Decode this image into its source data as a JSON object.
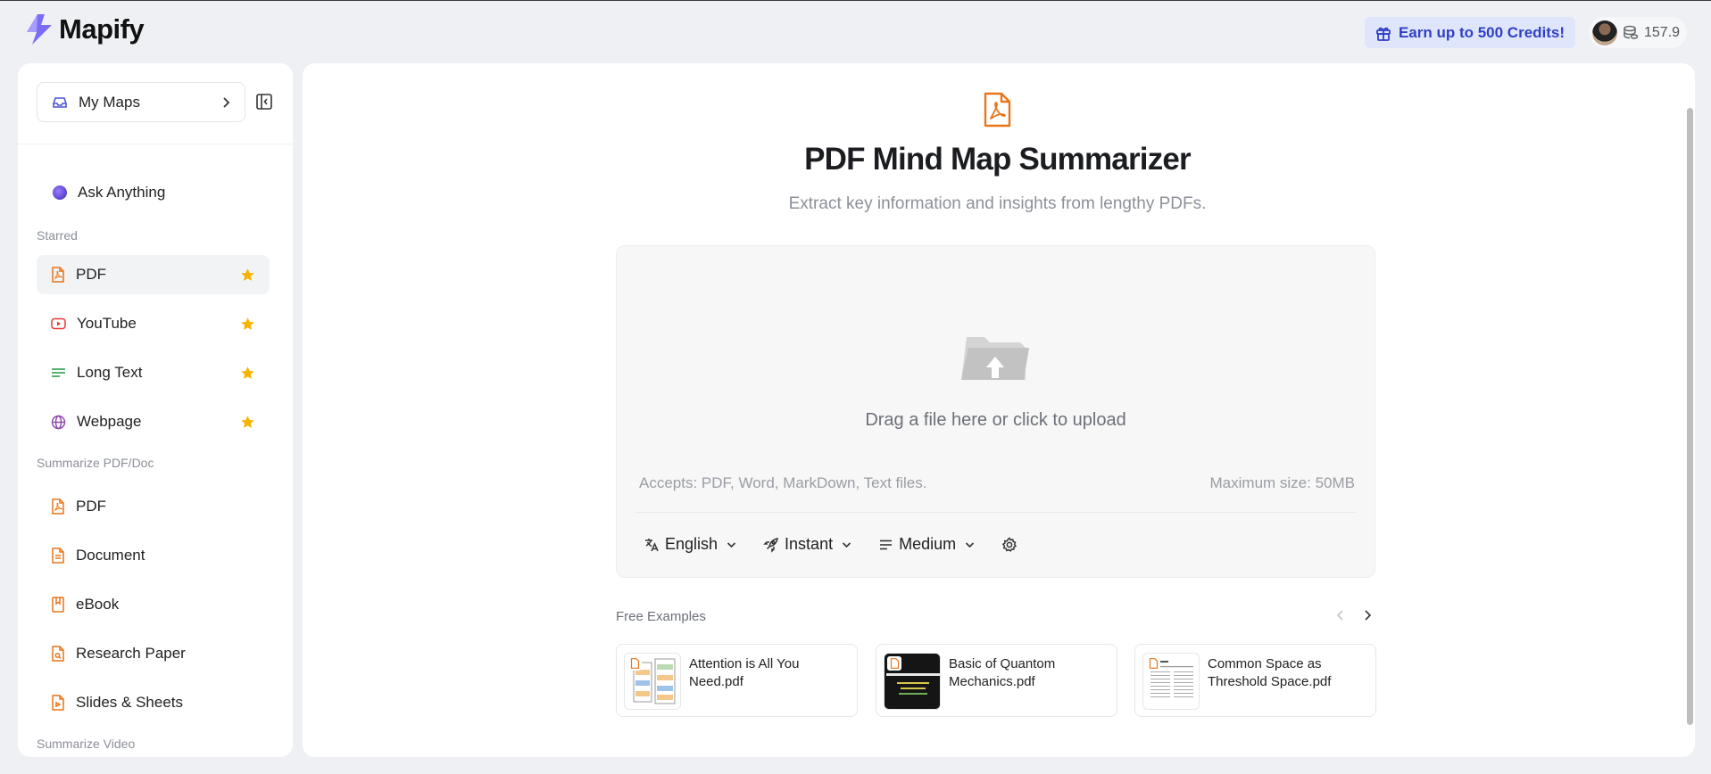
{
  "app": {
    "name": "Mapify"
  },
  "header": {
    "credits_label": "Earn up to 500 Credits!",
    "credit_balance": "157.9"
  },
  "sidebar": {
    "my_maps_label": "My Maps",
    "ask_anything": "Ask Anything",
    "starred_title": "Starred",
    "starred": [
      {
        "label": "PDF",
        "icon": "pdf-icon",
        "color": "#e8751a"
      },
      {
        "label": "YouTube",
        "icon": "youtube-icon",
        "color": "#e53935"
      },
      {
        "label": "Long Text",
        "icon": "long-text-icon",
        "color": "#2e9e4f"
      },
      {
        "label": "Webpage",
        "icon": "globe-icon",
        "color": "#8e44ad"
      }
    ],
    "summarize_doc_title": "Summarize PDF/Doc",
    "summarize_doc": [
      {
        "label": "PDF",
        "icon": "pdf-icon"
      },
      {
        "label": "Document",
        "icon": "document-icon"
      },
      {
        "label": "eBook",
        "icon": "ebook-icon"
      },
      {
        "label": "Research Paper",
        "icon": "research-paper-icon"
      },
      {
        "label": "Slides & Sheets",
        "icon": "slides-icon"
      }
    ],
    "summarize_video_title": "Summarize Video"
  },
  "main": {
    "title": "PDF Mind Map Summarizer",
    "subtitle": "Extract key information and insights from lengthy PDFs.",
    "upload": {
      "drag_text": "Drag a file here or click to upload",
      "accepts": "Accepts: PDF, Word, MarkDown, Text files.",
      "max_size": "Maximum size: 50MB"
    },
    "options": {
      "language": "English",
      "mode": "Instant",
      "length": "Medium"
    },
    "examples_title": "Free Examples",
    "examples": [
      {
        "name": "Attention is All You Need.pdf"
      },
      {
        "name": "Basic of Quantom Mechanics.pdf"
      },
      {
        "name": "Common Space as Threshold Space.pdf"
      }
    ]
  },
  "colors": {
    "accent": "#e8751a",
    "credits_bg": "#dfe6fb",
    "credits_text": "#2f3fc6",
    "star": "#f5b400"
  }
}
